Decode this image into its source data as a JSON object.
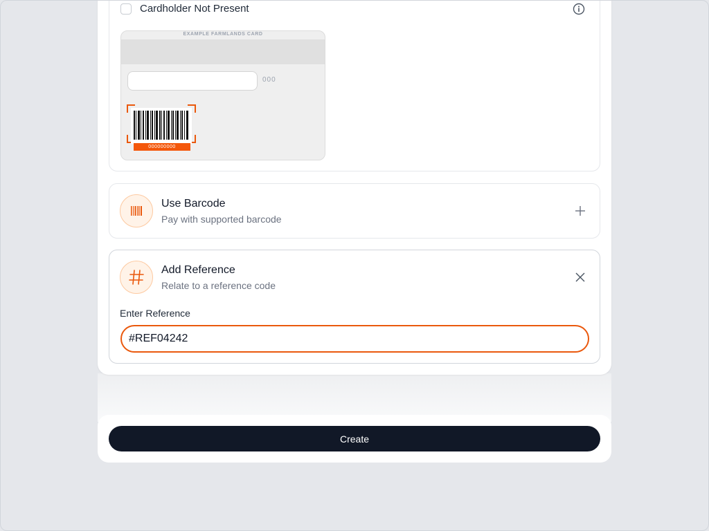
{
  "cardholder": {
    "label": "Cardholder Not Present",
    "card_example": {
      "title": "EXAMPLE FARMLANDS CARD",
      "cvv_placeholder": "000",
      "barcode_number": "000000000"
    }
  },
  "barcode_option": {
    "title": "Use Barcode",
    "subtitle": "Pay with supported barcode"
  },
  "reference_option": {
    "title": "Add Reference",
    "subtitle": "Relate to a reference code",
    "field_label": "Enter Reference",
    "field_value": "#REF04242"
  },
  "footer": {
    "create_label": "Create"
  },
  "colors": {
    "accent": "#ea580c",
    "primary_button": "#111827",
    "page_background": "#e5e7eb"
  }
}
